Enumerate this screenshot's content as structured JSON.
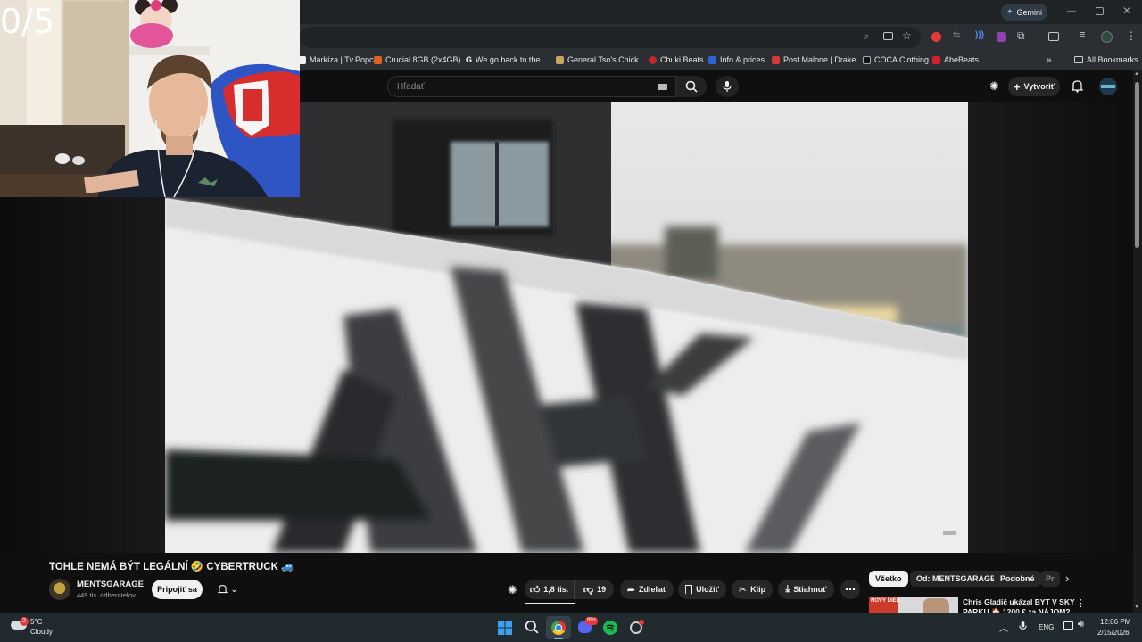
{
  "overlay": {
    "counter": "0/5"
  },
  "chrome": {
    "gemini_label": "Gemini",
    "bookmarks": [
      {
        "label": "Markíza | Tv.Popcor...",
        "color": "#f2f2f2"
      },
      {
        "label": "Crucial 8GB (2x4GB)...",
        "color": "#e0601e"
      },
      {
        "label": "We go back to the...",
        "color": "#ffffff"
      },
      {
        "label": "General Tso's Chick...",
        "color": "#c9a46a"
      },
      {
        "label": "Chuki Beats",
        "color": "#c2272d"
      },
      {
        "label": "Info & prices",
        "color": "#2d63d8"
      },
      {
        "label": "Post Malone | Drake...",
        "color": "#d23a3a"
      },
      {
        "label": "COCA Clothing",
        "color": "#111111"
      },
      {
        "label": "AbeBeats",
        "color": "#d21f2b"
      }
    ],
    "all_bookmarks": "All Bookmarks"
  },
  "youtube": {
    "search_placeholder": "Hľadať",
    "create_label": "Vytvoriť",
    "video_title": "TOHLE NEMÁ BÝT LEGÁLNÍ 🤣 CYBERTRUCK 🚙",
    "channel_name": "MENTSGARAGE",
    "subscribers": "449 tis. odberateľov",
    "join_label": "Pripojiť sa",
    "likes": "1,8 tis.",
    "dislikes": "19",
    "share": "Zdieľať",
    "save": "Uložiť",
    "clip": "Klip",
    "download": "Stiahnuť",
    "chips": [
      "Všetko",
      "Od: MENTSGARAGE",
      "Podobné",
      "Pr"
    ],
    "rec_title_line1": "Chris Gladič ukázal BYT V SKY",
    "rec_title_line2": "PARKU 🏠 1200 € za NÁJOM?",
    "rec_badge": "NOVÝ DIEL"
  },
  "taskbar": {
    "weather_temp": "5°C",
    "weather_desc": "Cloudy",
    "weather_badge": "2",
    "lang": "ENG",
    "time": "12:06 PM",
    "date": "2/15/2026",
    "discord_badge": "99+"
  },
  "colors": {
    "yt_bg": "#0f0f0f",
    "chip_active_bg": "#f1f1f1",
    "accent_red": "#ff0033"
  }
}
